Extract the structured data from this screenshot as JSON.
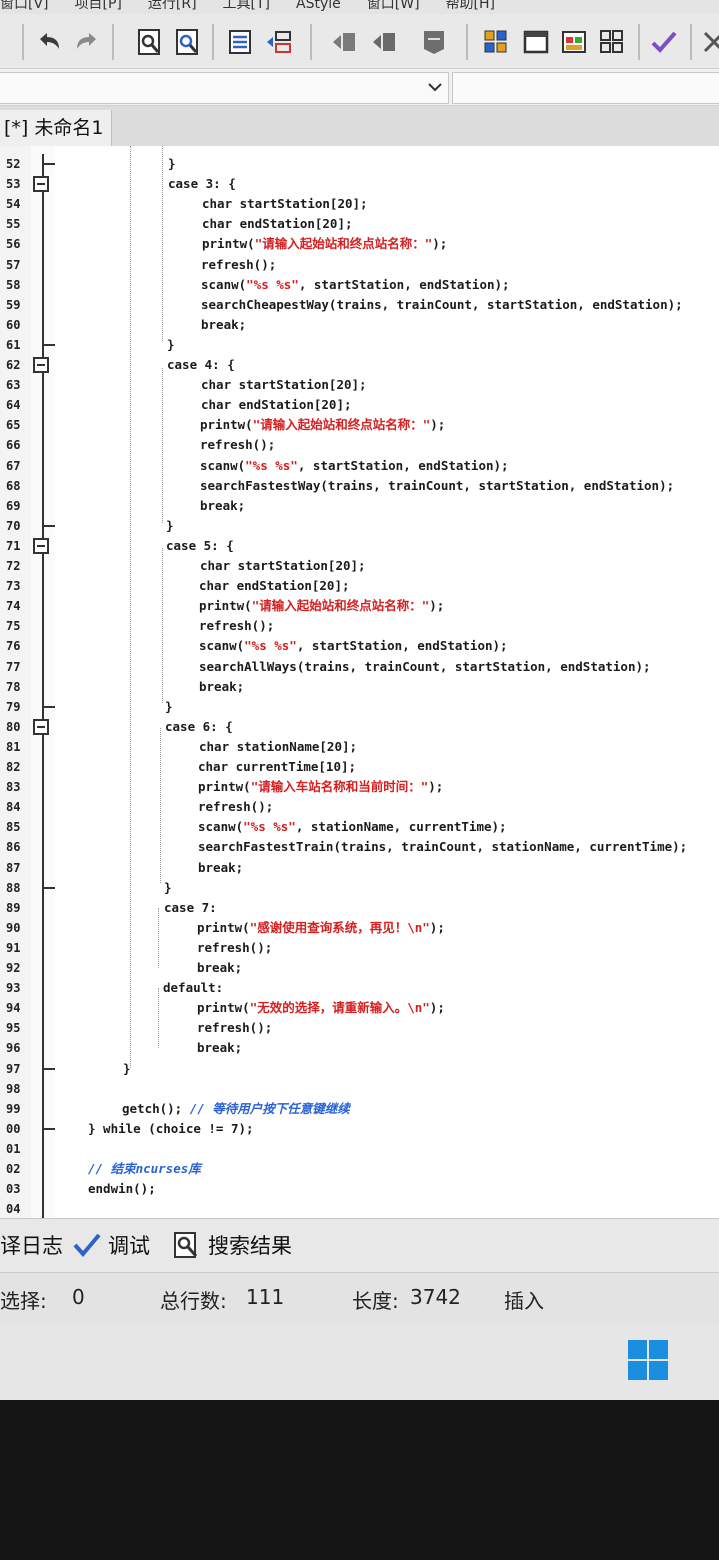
{
  "menu": {
    "items": [
      "窗口[V]",
      "项目[P]",
      "运行[R]",
      "工具[T]",
      "AStyle",
      "窗口[W]",
      "帮助[H]"
    ]
  },
  "toolbar": {
    "icons": [
      "undo-icon",
      "redo-icon",
      "find-icon",
      "replace-icon",
      "indent-icon",
      "unindent-icon",
      "bookmark-prev-icon",
      "bookmark-next-icon",
      "bookmark-icon",
      "grid-icon",
      "window-icon",
      "colors-icon",
      "tiles-icon",
      "check-icon"
    ]
  },
  "tab": {
    "label": "[*] 未命名1"
  },
  "code_lines": [
    {
      "n": "52",
      "text": "}",
      "indent": 0
    },
    {
      "n": "53",
      "text": "case 3: {",
      "indent": 0
    },
    {
      "n": "54",
      "text": "char startStation[20];",
      "indent": 1
    },
    {
      "n": "55",
      "text": "char endStation[20];",
      "indent": 1
    },
    {
      "n": "56",
      "pre": "printw(",
      "str": "\"请输入起始站和终点站名称：\"",
      "post": ");",
      "indent": 1
    },
    {
      "n": "57",
      "text": "refresh();",
      "indent": 1
    },
    {
      "n": "58",
      "pre": "scanw(",
      "str": "\"%s %s\"",
      "post": ", startStation, endStation);",
      "indent": 1
    },
    {
      "n": "59",
      "text": "searchCheapestWay(trains, trainCount, startStation, endStation);",
      "indent": 1
    },
    {
      "n": "60",
      "text": "break;",
      "indent": 1
    },
    {
      "n": "61",
      "text": "}",
      "indent": 0
    },
    {
      "n": "62",
      "text": "case 4: {",
      "indent": 0
    },
    {
      "n": "63",
      "text": "char startStation[20];",
      "indent": 1
    },
    {
      "n": "64",
      "text": "char endStation[20];",
      "indent": 1
    },
    {
      "n": "65",
      "pre": "printw(",
      "str": "\"请输入起始站和终点站名称：\"",
      "post": ");",
      "indent": 1
    },
    {
      "n": "66",
      "text": "refresh();",
      "indent": 1
    },
    {
      "n": "67",
      "pre": "scanw(",
      "str": "\"%s %s\"",
      "post": ", startStation, endStation);",
      "indent": 1
    },
    {
      "n": "68",
      "text": "searchFastestWay(trains, trainCount, startStation, endStation);",
      "indent": 1
    },
    {
      "n": "69",
      "text": "break;",
      "indent": 1
    },
    {
      "n": "70",
      "text": "}",
      "indent": 0
    },
    {
      "n": "71",
      "text": "case 5: {",
      "indent": 0
    },
    {
      "n": "72",
      "text": "char startStation[20];",
      "indent": 1
    },
    {
      "n": "73",
      "text": "char endStation[20];",
      "indent": 1
    },
    {
      "n": "74",
      "pre": "printw(",
      "str": "\"请输入起始站和终点站名称：\"",
      "post": ");",
      "indent": 1
    },
    {
      "n": "75",
      "text": "refresh();",
      "indent": 1
    },
    {
      "n": "76",
      "pre": "scanw(",
      "str": "\"%s %s\"",
      "post": ", startStation, endStation);",
      "indent": 1
    },
    {
      "n": "77",
      "text": "searchAllWays(trains, trainCount, startStation, endStation);",
      "indent": 1
    },
    {
      "n": "78",
      "text": "break;",
      "indent": 1
    },
    {
      "n": "79",
      "text": "}",
      "indent": 0
    },
    {
      "n": "80",
      "text": "case 6: {",
      "indent": 0
    },
    {
      "n": "81",
      "text": "char stationName[20];",
      "indent": 1
    },
    {
      "n": "82",
      "text": "char currentTime[10];",
      "indent": 1
    },
    {
      "n": "83",
      "pre": "printw(",
      "str": "\"请输入车站名称和当前时间：\"",
      "post": ");",
      "indent": 1
    },
    {
      "n": "84",
      "text": "refresh();",
      "indent": 1
    },
    {
      "n": "85",
      "pre": "scanw(",
      "str": "\"%s %s\"",
      "post": ", stationName, currentTime);",
      "indent": 1
    },
    {
      "n": "86",
      "text": "searchFastestTrain(trains, trainCount, stationName, currentTime);",
      "indent": 1
    },
    {
      "n": "87",
      "text": "break;",
      "indent": 1
    },
    {
      "n": "88",
      "text": "}",
      "indent": 0
    },
    {
      "n": "89",
      "text": "case 7:",
      "indent": 0
    },
    {
      "n": "90",
      "pre": "printw(",
      "str": "\"感谢使用查询系统，再见！\\n\"",
      "post": ");",
      "indent": 1
    },
    {
      "n": "91",
      "text": "refresh();",
      "indent": 1
    },
    {
      "n": "92",
      "text": "break;",
      "indent": 1
    },
    {
      "n": "93",
      "text": "default:",
      "indent": 0
    },
    {
      "n": "94",
      "pre": "printw(",
      "str": "\"无效的选择，请重新输入。\\n\"",
      "post": ");",
      "indent": 1
    },
    {
      "n": "95",
      "text": "refresh();",
      "indent": 1
    },
    {
      "n": "96",
      "text": "break;",
      "indent": 1
    },
    {
      "n": "97",
      "text": "}",
      "indent": -1
    },
    {
      "n": "98",
      "text": "",
      "indent": -1
    },
    {
      "n": "99",
      "pre": "getch(); ",
      "cmt": "// 等待用户按下任意键继续",
      "post": "",
      "indent": -1
    },
    {
      "n": "00",
      "text": "} while (choice != 7);",
      "indent": -2
    },
    {
      "n": "01",
      "text": "",
      "indent": -2
    },
    {
      "n": "02",
      "pre": "",
      "cmt": "// 结束ncurses库",
      "post": "",
      "indent": -2
    },
    {
      "n": "03",
      "text": "endwin();",
      "indent": -2
    },
    {
      "n": "04",
      "text": "",
      "indent": -2
    }
  ],
  "bottom_tabs": [
    {
      "label": "译日志",
      "icon": "log-icon"
    },
    {
      "label": "调试",
      "icon": "debug-check-icon"
    },
    {
      "label": "搜索结果",
      "icon": "search-results-icon"
    }
  ],
  "status": {
    "select_label": "选择:",
    "select_value": "0",
    "lines_label": "总行数:",
    "lines_value": "111",
    "length_label": "长度:",
    "length_value": "3742",
    "mode": "插入"
  },
  "colors": {
    "string": "#d42020",
    "comment": "#2a63d6",
    "code": "#1b1b1b"
  }
}
